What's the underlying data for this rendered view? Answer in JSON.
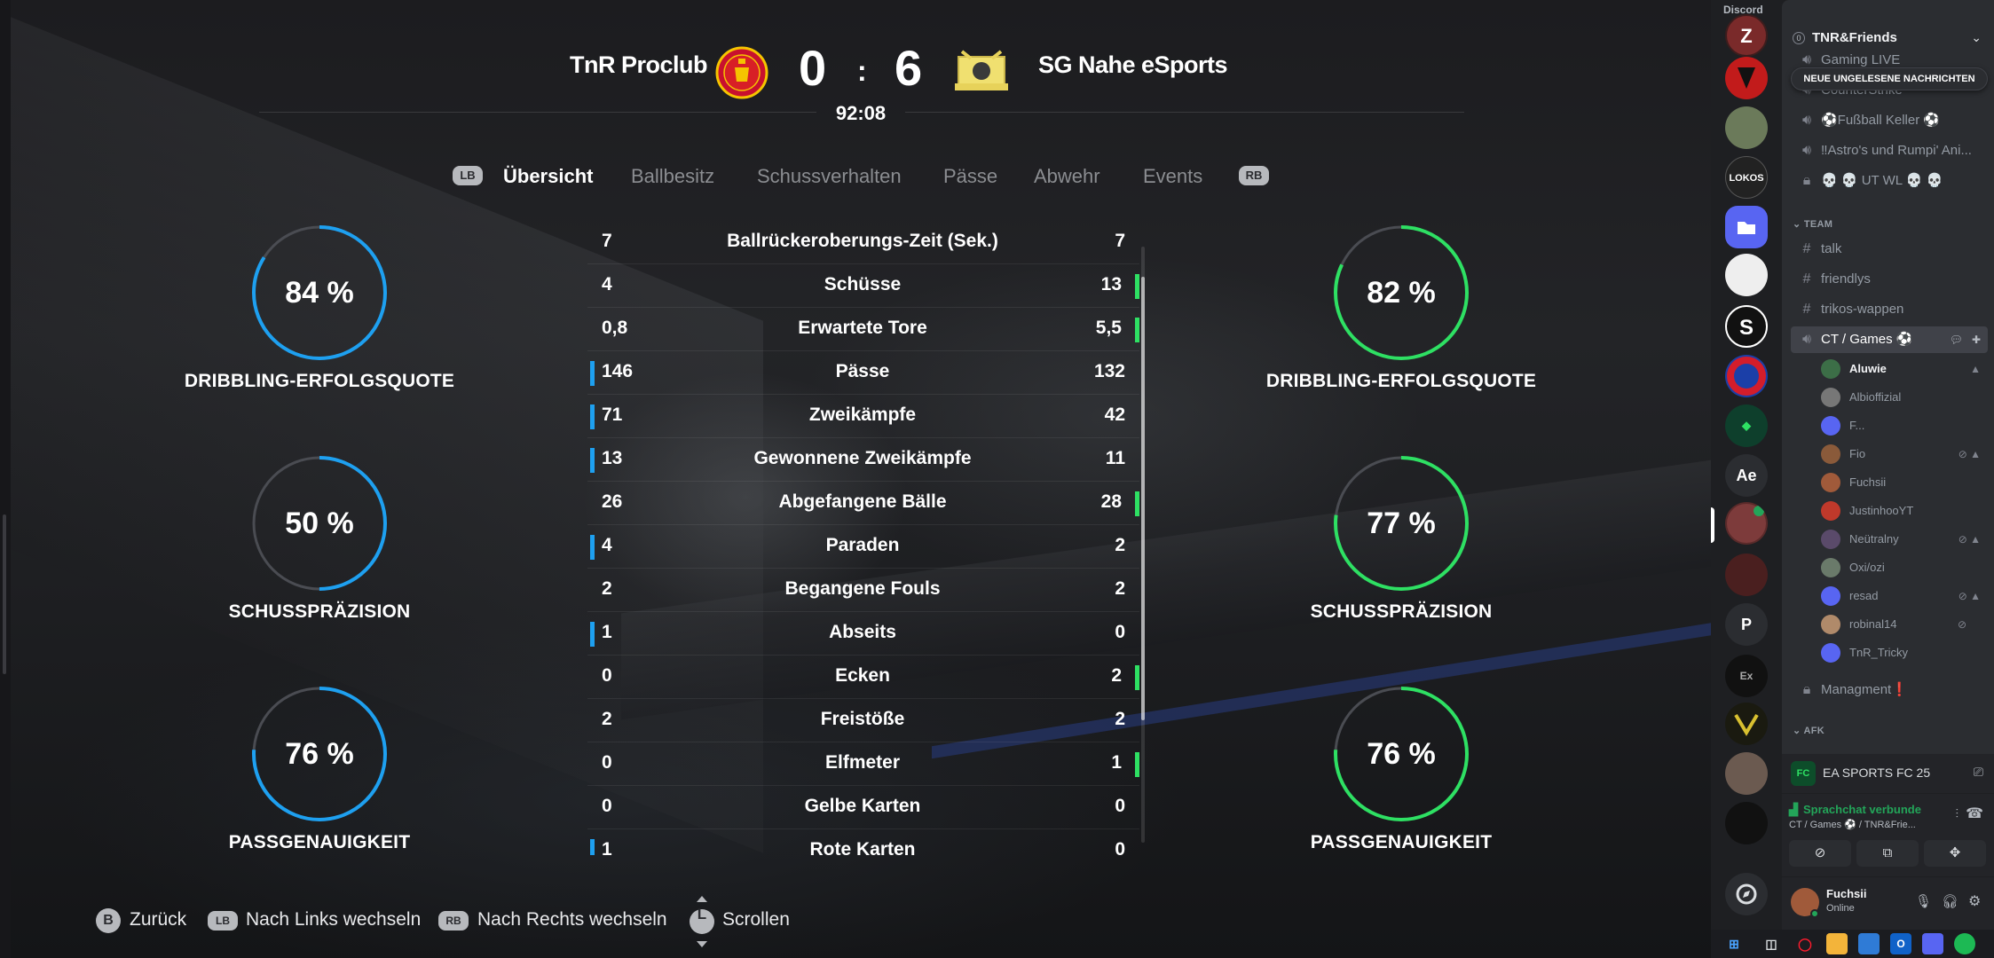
{
  "match": {
    "home_team": "TnR Proclub",
    "away_team": "SG Nahe eSports",
    "home_score": "0",
    "away_score": "6",
    "separator": ":",
    "time": "92:08"
  },
  "tabs": {
    "lb": "LB",
    "rb": "RB",
    "items": [
      "Übersicht",
      "Ballbesitz",
      "Schussverhalten",
      "Pässe",
      "Abwehr",
      "Events"
    ],
    "active_index": 0
  },
  "home_stats": [
    {
      "value_text": "84 %",
      "value": 84,
      "label": "DRIBBLING-ERFOLGSQUOTE"
    },
    {
      "value_text": "50 %",
      "value": 50,
      "label": "SCHUSSPRÄZISION"
    },
    {
      "value_text": "76 %",
      "value": 76,
      "label": "PASSGENAUIGKEIT"
    }
  ],
  "away_stats": [
    {
      "value_text": "82 %",
      "value": 82,
      "label": "DRIBBLING-ERFOLGSQUOTE"
    },
    {
      "value_text": "77 %",
      "value": 77,
      "label": "SCHUSSPRÄZISION"
    },
    {
      "value_text": "76 %",
      "value": 76,
      "label": "PASSGENAUIGKEIT"
    }
  ],
  "colors": {
    "home_accent": "#1ea0f0",
    "away_accent": "#2ee063",
    "donut_track": "#4a4c52"
  },
  "table": [
    {
      "home": "7",
      "name": "Ballrückeroberungs-Zeit (Sek.)",
      "away": "7",
      "lead": ""
    },
    {
      "home": "4",
      "name": "Schüsse",
      "away": "13",
      "lead": "away"
    },
    {
      "home": "0,8",
      "name": "Erwartete Tore",
      "away": "5,5",
      "lead": "away"
    },
    {
      "home": "146",
      "name": "Pässe",
      "away": "132",
      "lead": "home"
    },
    {
      "home": "71",
      "name": "Zweikämpfe",
      "away": "42",
      "lead": "home"
    },
    {
      "home": "13",
      "name": "Gewonnene Zweikämpfe",
      "away": "11",
      "lead": "home"
    },
    {
      "home": "26",
      "name": "Abgefangene Bälle",
      "away": "28",
      "lead": "away"
    },
    {
      "home": "4",
      "name": "Paraden",
      "away": "2",
      "lead": "home"
    },
    {
      "home": "2",
      "name": "Begangene Fouls",
      "away": "2",
      "lead": ""
    },
    {
      "home": "1",
      "name": "Abseits",
      "away": "0",
      "lead": "home"
    },
    {
      "home": "0",
      "name": "Ecken",
      "away": "2",
      "lead": "away"
    },
    {
      "home": "2",
      "name": "Freistöße",
      "away": "2",
      "lead": ""
    },
    {
      "home": "0",
      "name": "Elfmeter",
      "away": "1",
      "lead": "away"
    },
    {
      "home": "0",
      "name": "Gelbe Karten",
      "away": "0",
      "lead": ""
    },
    {
      "home": "1",
      "name": "Rote Karten",
      "away": "0",
      "lead": "home"
    }
  ],
  "footer": {
    "back_key": "B",
    "back_label": "Zurück",
    "lb_key": "LB",
    "lb_label": "Nach Links wechseln",
    "rb_key": "RB",
    "rb_label": "Nach Rechts wechseln",
    "scroll_key": "L",
    "scroll_label": "Scrollen"
  },
  "discord": {
    "app_title": "Discord",
    "server_name": "TNR&Friends",
    "server_icon_texts": [
      "Ae",
      "P",
      "Ex"
    ],
    "unread_banner": "NEUE UNGELESENE NACHRICHTEN",
    "channels_top": [
      {
        "name": "Gaming LIVE",
        "icon": "speaker-icon"
      },
      {
        "name": "CounterStrike",
        "icon": "speaker-icon"
      },
      {
        "name": "⚽Fußball Keller ⚽",
        "icon": "speaker-icon"
      },
      {
        "name": "‼Astro's und Rumpi' Ani...",
        "icon": "speaker-icon"
      },
      {
        "name": "💀 💀  UT WL  💀 💀",
        "icon": "lock-icon"
      }
    ],
    "category_team": "TEAM",
    "team_channels": [
      {
        "name": "talk",
        "icon": "hash-icon"
      },
      {
        "name": "friendlys",
        "icon": "hash-icon"
      },
      {
        "name": "trikos-wappen",
        "icon": "hash-icon"
      },
      {
        "name": "CT / Games ⚽",
        "icon": "speaker-icon"
      }
    ],
    "voice_users": [
      "Aluwie",
      "Albioffizial",
      "F...",
      "Fio",
      "Fuchsii",
      "JustinhooYT",
      "Neütralny",
      "Oxi/ozi",
      "resad",
      "robinal14",
      "TnR_Tricky"
    ],
    "managment_channel": "Managment❗",
    "category_afk": "AFK",
    "activity_name": "EA SPORTS FC 25",
    "voice_status": "Sprachchat verbunde",
    "voice_channel": "CT / Games ⚽ / TNR&Frie...",
    "user_name": "Fuchsii",
    "user_status": "Online"
  }
}
